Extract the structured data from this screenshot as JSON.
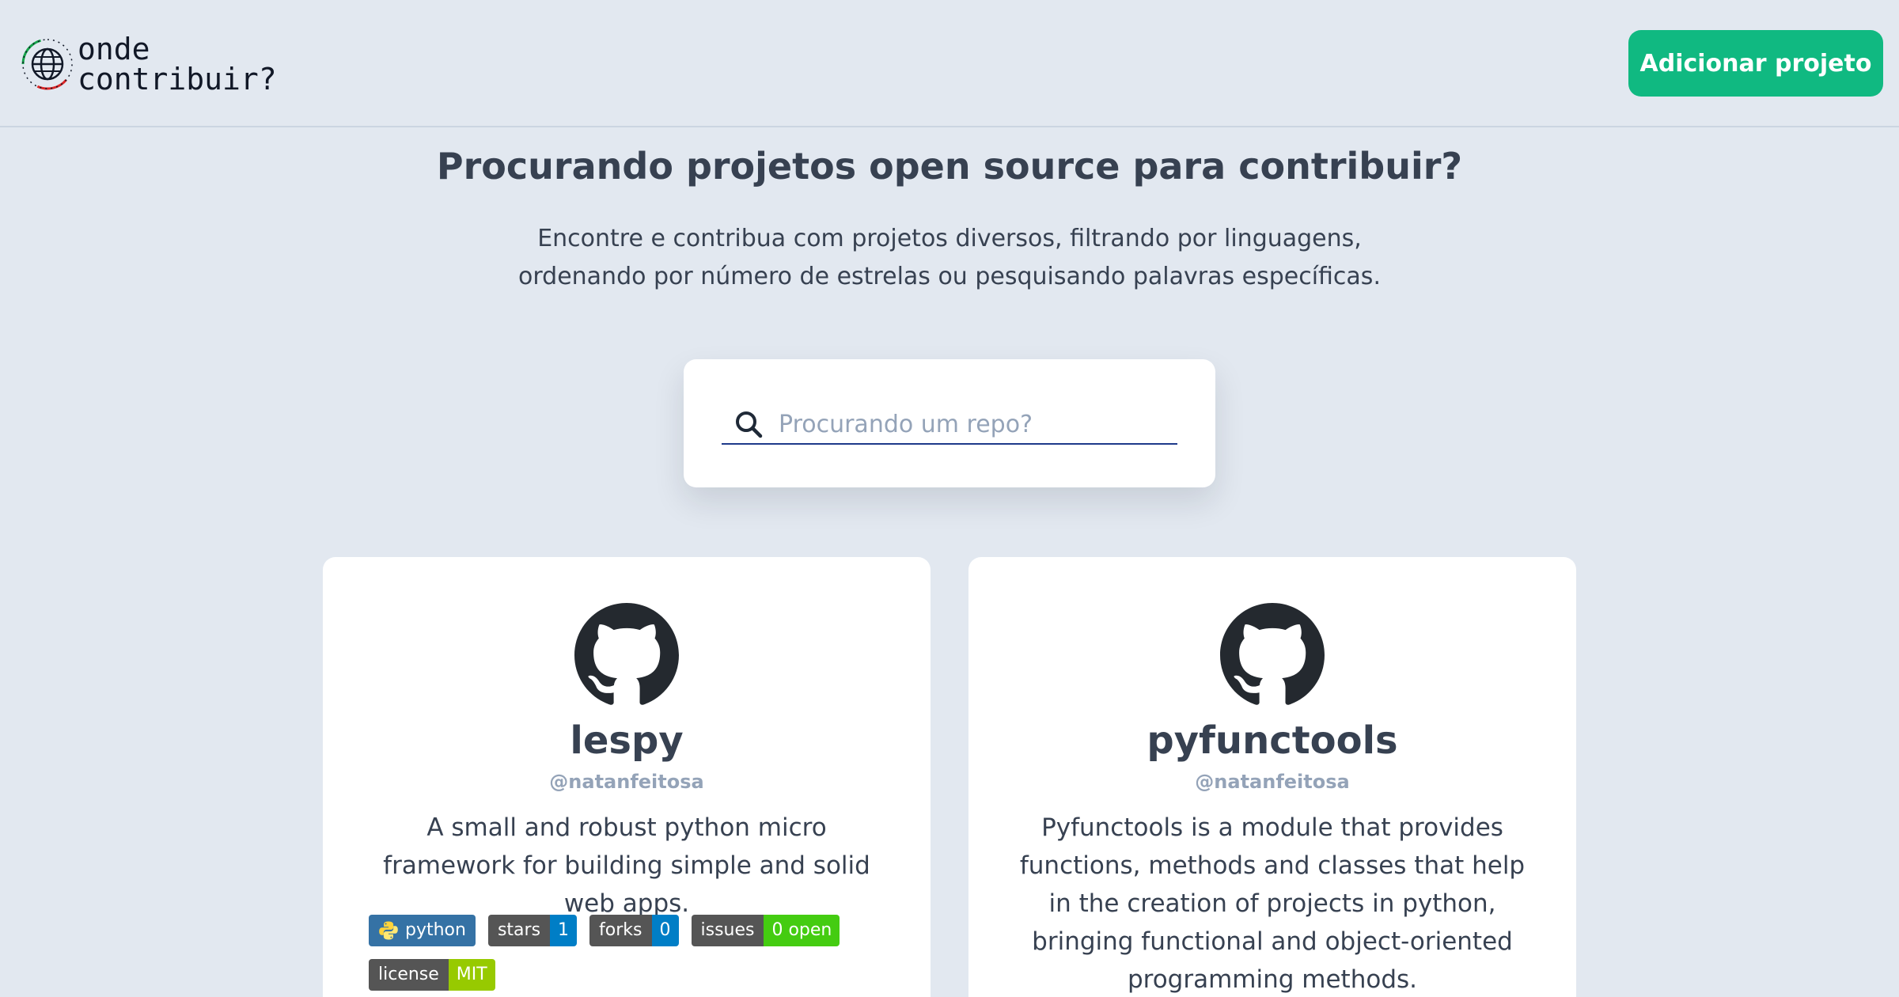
{
  "header": {
    "logo_line1": "onde",
    "logo_line2": "contribuir?",
    "add_button": "Adicionar projeto"
  },
  "hero": {
    "title": "Procurando projetos open source para contribuir?",
    "subtitle_line1": "Encontre e contribua com projetos diversos, filtrando por linguagens,",
    "subtitle_line2": "ordenando por número de estrelas ou pesquisando palavras específicas."
  },
  "search": {
    "placeholder": "Procurando um repo?",
    "value": ""
  },
  "cards": [
    {
      "name": "lespy",
      "owner": "@natanfeitosa",
      "description": "A small and robust python micro framework for building simple and solid web apps.",
      "badges": {
        "language": "python",
        "stars_label": "stars",
        "stars_value": "1",
        "forks_label": "forks",
        "forks_value": "0",
        "issues_label": "issues",
        "issues_value": "0 open",
        "license_label": "license",
        "license_value": "MIT"
      }
    },
    {
      "name": "pyfunctools",
      "owner": "@natanfeitosa",
      "description": "Pyfunctools is a module that provides functions, methods and classes that help in the creation of projects in python, bringing functional and object-oriented programming methods."
    }
  ],
  "colors": {
    "background": "#e2e8f0",
    "accent_green": "#10b981",
    "search_underline": "#1e3a8a",
    "badge_blue": "#007ec6",
    "badge_green": "#4c1",
    "badge_lime": "#97ca00"
  }
}
